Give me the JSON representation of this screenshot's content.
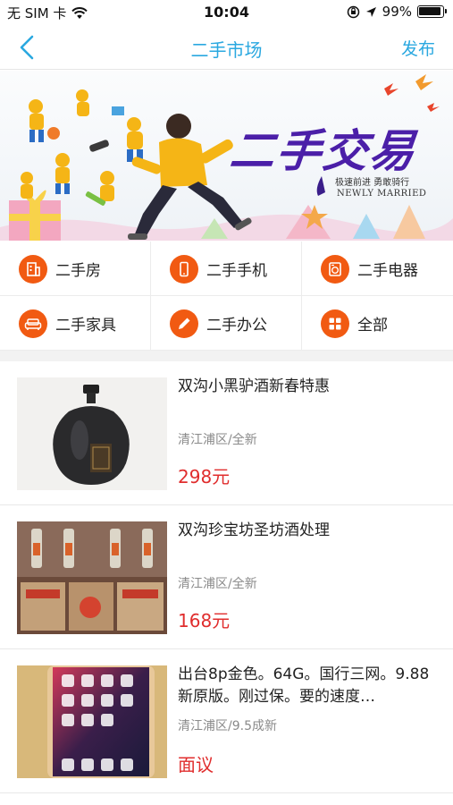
{
  "status_bar": {
    "carrier": "无 SIM 卡",
    "time": "10:04",
    "battery": "99%"
  },
  "nav": {
    "title": "二手市场",
    "action": "发布"
  },
  "banner": {
    "title": "二手交易",
    "subtitle": "极速前进 勇敢骑行",
    "english": "NEWLY MARRIED"
  },
  "categories": [
    {
      "label": "二手房",
      "icon": "house-icon"
    },
    {
      "label": "二手手机",
      "icon": "phone-icon"
    },
    {
      "label": "二手电器",
      "icon": "washing-machine-icon"
    },
    {
      "label": "二手家具",
      "icon": "sofa-icon"
    },
    {
      "label": "二手办公",
      "icon": "pencil-icon"
    },
    {
      "label": "全部",
      "icon": "grid-icon"
    }
  ],
  "listings": [
    {
      "title": "双沟小黑驴酒新春特惠",
      "meta": "清江浦区/全新",
      "price": "298元"
    },
    {
      "title": "双沟珍宝坊圣坊酒处理",
      "meta": "清江浦区/全新",
      "price": "168元"
    },
    {
      "title": "出台8p金色。64G。国行三网。9.88新原版。刚过保。要的速度…",
      "meta": "清江浦区/9.5成新",
      "price": "面议"
    }
  ],
  "colors": {
    "accent": "#2aa8e0",
    "category_icon": "#f15a12",
    "price": "#e02d2d"
  }
}
